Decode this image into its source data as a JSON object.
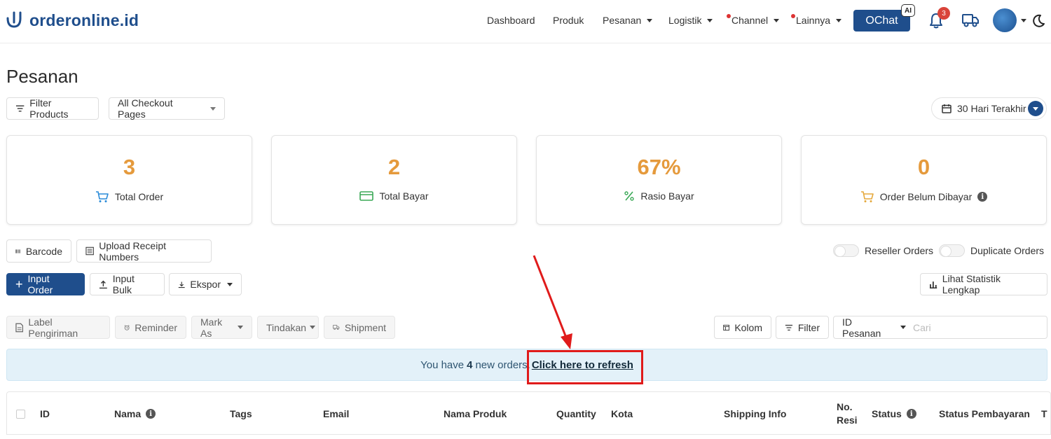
{
  "brand": {
    "name": "orderonline.id"
  },
  "nav": {
    "dashboard": "Dashboard",
    "produk": "Produk",
    "pesanan": "Pesanan",
    "logistik": "Logistik",
    "channel": "Channel",
    "lainnya": "Lainnya",
    "ochat": "OChat",
    "ai_badge": "AI",
    "notif_count": "3"
  },
  "page": {
    "title": "Pesanan"
  },
  "filters": {
    "filter_products": "Filter Products",
    "checkout_pages": "All Checkout Pages",
    "date_range": "30 Hari Terakhir"
  },
  "stats": [
    {
      "value": "3",
      "label": "Total Order",
      "icon": "cart-icon",
      "color": "#2a8bd8"
    },
    {
      "value": "2",
      "label": "Total Bayar",
      "icon": "credit-card-icon",
      "color": "#3aa856"
    },
    {
      "value": "67%",
      "label": "Rasio Bayar",
      "icon": "percent-icon",
      "color": "#3aa856"
    },
    {
      "value": "0",
      "label": "Order Belum Dibayar",
      "icon": "cart-icon",
      "color": "#e5a83c"
    }
  ],
  "actions": {
    "barcode": "Barcode",
    "upload_receipt": "Upload Receipt Numbers",
    "reseller_orders": "Reseller Orders",
    "duplicate_orders": "Duplicate Orders",
    "input_order": "Input Order",
    "input_bulk": "Input Bulk",
    "ekspor": "Ekspor",
    "lihat_statistik": "Lihat Statistik Lengkap"
  },
  "toolbar": {
    "label_pengiriman": "Label Pengiriman",
    "reminder": "Reminder",
    "mark_as": "Mark As",
    "tindakan": "Tindakan",
    "shipment": "Shipment",
    "kolom": "Kolom",
    "filter": "Filter",
    "id_pesanan": "ID Pesanan",
    "search_placeholder": "Cari"
  },
  "alert": {
    "prefix": "You have",
    "count": "4",
    "suffix": "new orders.",
    "link": "Click here to refresh"
  },
  "table": {
    "columns": [
      "ID",
      "Nama",
      "Tags",
      "Email",
      "Nama Produk",
      "Quantity",
      "Kota",
      "Shipping Info",
      "No.",
      "Resi",
      "Status",
      "Status Pembayaran",
      "T"
    ]
  },
  "colors": {
    "primary": "#1f4e8c",
    "stat_value": "#e59a3c",
    "annotation_red": "#e01b1b",
    "alert_bg": "#e3f1f9"
  }
}
